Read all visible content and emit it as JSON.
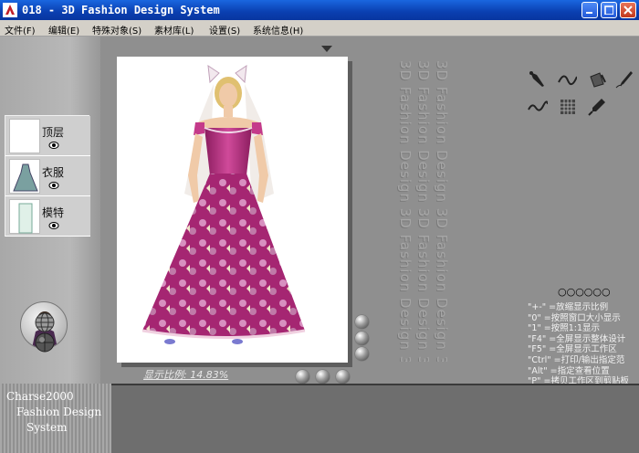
{
  "window": {
    "title": "018 - 3D Fashion Design System"
  },
  "menu": [
    {
      "label": "文件(F)"
    },
    {
      "label": "编辑(E)"
    },
    {
      "label": "特殊对象(S)"
    },
    {
      "label": "素材库(L)"
    },
    {
      "label": "设置(S)"
    },
    {
      "label": "系统信息(H)"
    }
  ],
  "layers": [
    {
      "label": "顶层"
    },
    {
      "label": "衣服"
    },
    {
      "label": "模特"
    }
  ],
  "watermark": "3D Fashion Design 3D Fashion Design 3D Fas",
  "canvas": {
    "scale_label": "显示比例: 14.83%"
  },
  "help": {
    "dots": "○○○○○○",
    "lines": [
      "\"+-\" =放缩显示比例",
      "\"0\" =按照窗口大小显示",
      "\"1\" =按照1:1显示",
      "\"F4\" =全屏显示整体设计",
      "\"F5\" =全屏显示工作区",
      "\"Ctrl\" =打印/输出指定范",
      "\"Alt\" =指定查看位置",
      "\"P\" =拷贝工作区到剪贴板"
    ]
  },
  "brand": {
    "line1": "Charse2000",
    "line2": "Fashion Design",
    "line3": "System"
  },
  "colors": {
    "titlebar": "#0a3fb0",
    "dress": "#b0287a",
    "background": "#8f8f8f"
  },
  "icons": {
    "tools": [
      "pen-tool-icon",
      "curve-icon",
      "fill-icon",
      "brush-icon",
      "wave-icon",
      "grid-icon",
      "eyedropper-icon"
    ]
  }
}
